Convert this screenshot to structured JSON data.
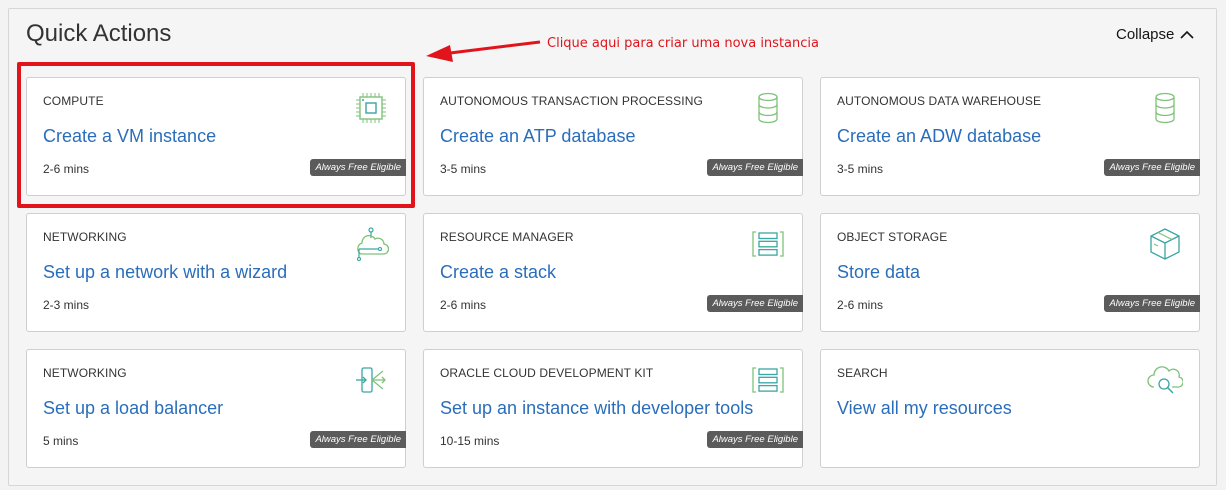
{
  "panel": {
    "title": "Quick Actions",
    "collapse_label": "Collapse"
  },
  "annotation": {
    "text": "Clique aqui para criar uma nova instancia",
    "color": "#e1141c"
  },
  "colors": {
    "link": "#2a6ebb",
    "badge_bg": "#5b5b5b",
    "icon_green": "#7fc27a",
    "icon_teal": "#3aa6a0"
  },
  "cards": [
    {
      "category": "COMPUTE",
      "title": "Create a VM instance",
      "duration": "2-6 mins",
      "badge": "Always Free Eligible",
      "icon": "chip-icon"
    },
    {
      "category": "AUTONOMOUS TRANSACTION PROCESSING",
      "title": "Create an ATP database",
      "duration": "3-5 mins",
      "badge": "Always Free Eligible",
      "icon": "database-icon"
    },
    {
      "category": "AUTONOMOUS DATA WAREHOUSE",
      "title": "Create an ADW database",
      "duration": "3-5 mins",
      "badge": "Always Free Eligible",
      "icon": "database-icon"
    },
    {
      "category": "NETWORKING",
      "title": "Set up a network with a wizard",
      "duration": "2-3 mins",
      "badge": "",
      "icon": "cloud-network-icon"
    },
    {
      "category": "RESOURCE MANAGER",
      "title": "Create a stack",
      "duration": "2-6 mins",
      "badge": "Always Free Eligible",
      "icon": "stack-icon"
    },
    {
      "category": "OBJECT STORAGE",
      "title": "Store data",
      "duration": "2-6 mins",
      "badge": "Always Free Eligible",
      "icon": "box-icon"
    },
    {
      "category": "NETWORKING",
      "title": "Set up a load balancer",
      "duration": "5 mins",
      "badge": "Always Free Eligible",
      "icon": "load-balancer-icon"
    },
    {
      "category": "ORACLE CLOUD DEVELOPMENT KIT",
      "title": "Set up an instance with developer tools",
      "duration": "10-15 mins",
      "badge": "Always Free Eligible",
      "icon": "stack-icon"
    },
    {
      "category": "SEARCH",
      "title": "View all my resources",
      "duration": "",
      "badge": "",
      "icon": "cloud-search-icon"
    }
  ]
}
